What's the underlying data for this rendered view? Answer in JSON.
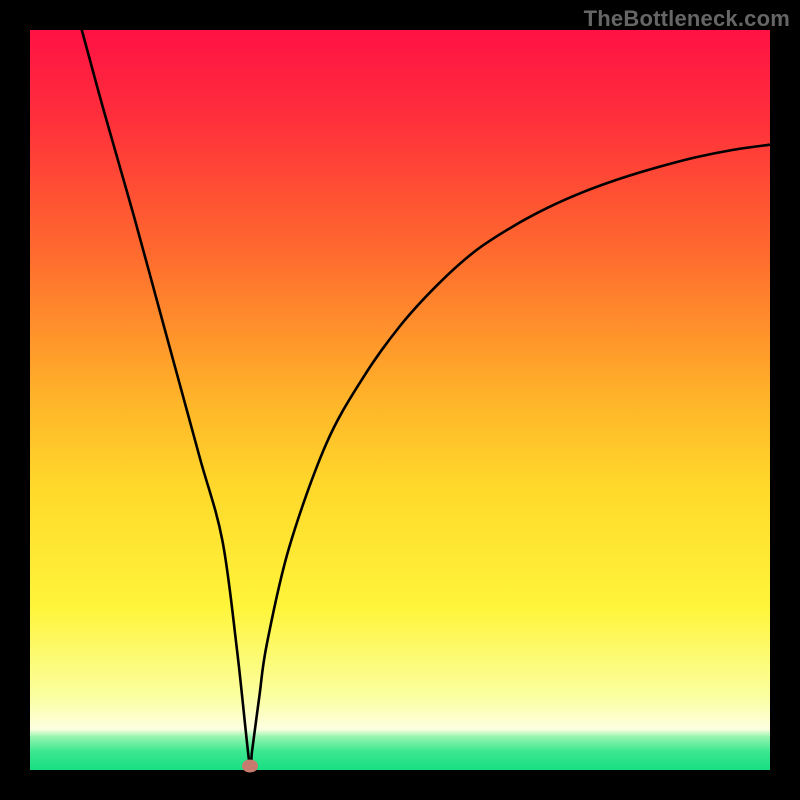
{
  "watermark": "TheBottleneck.com",
  "chart_data": {
    "type": "line",
    "title": "",
    "xlabel": "",
    "ylabel": "",
    "xlim": [
      0,
      100
    ],
    "ylim": [
      0,
      100
    ],
    "series": [
      {
        "name": "bottleneck-curve",
        "x": [
          7,
          10,
          14,
          17,
          20,
          23,
          26,
          28,
          29.7,
          30,
          31,
          32,
          35,
          40,
          45,
          50,
          55,
          60,
          65,
          70,
          75,
          80,
          85,
          90,
          95,
          100
        ],
        "y": [
          100,
          89,
          75,
          64,
          53,
          42,
          31,
          16,
          0.5,
          2.5,
          10,
          17,
          30,
          44,
          53,
          60,
          65.5,
          70,
          73.3,
          76,
          78.2,
          80,
          81.5,
          82.8,
          83.8,
          84.5
        ]
      }
    ],
    "green_band_top_pct": 94.5,
    "marker": {
      "x_pct": 29.7,
      "y_pct": 0.5,
      "color": "#c77b6f"
    },
    "gradient": {
      "stops": [
        {
          "pos": 0.0,
          "color": "#ff1245"
        },
        {
          "pos": 0.12,
          "color": "#ff2f3b"
        },
        {
          "pos": 0.3,
          "color": "#ff6a2e"
        },
        {
          "pos": 0.5,
          "color": "#ffb429"
        },
        {
          "pos": 0.62,
          "color": "#ffd92b"
        },
        {
          "pos": 0.78,
          "color": "#fff53a"
        },
        {
          "pos": 0.9,
          "color": "#fbffa0"
        },
        {
          "pos": 0.945,
          "color": "#fcffe0"
        },
        {
          "pos": 0.955,
          "color": "#96f5b0"
        },
        {
          "pos": 0.975,
          "color": "#3ce690"
        },
        {
          "pos": 1.0,
          "color": "#17df82"
        }
      ]
    }
  }
}
